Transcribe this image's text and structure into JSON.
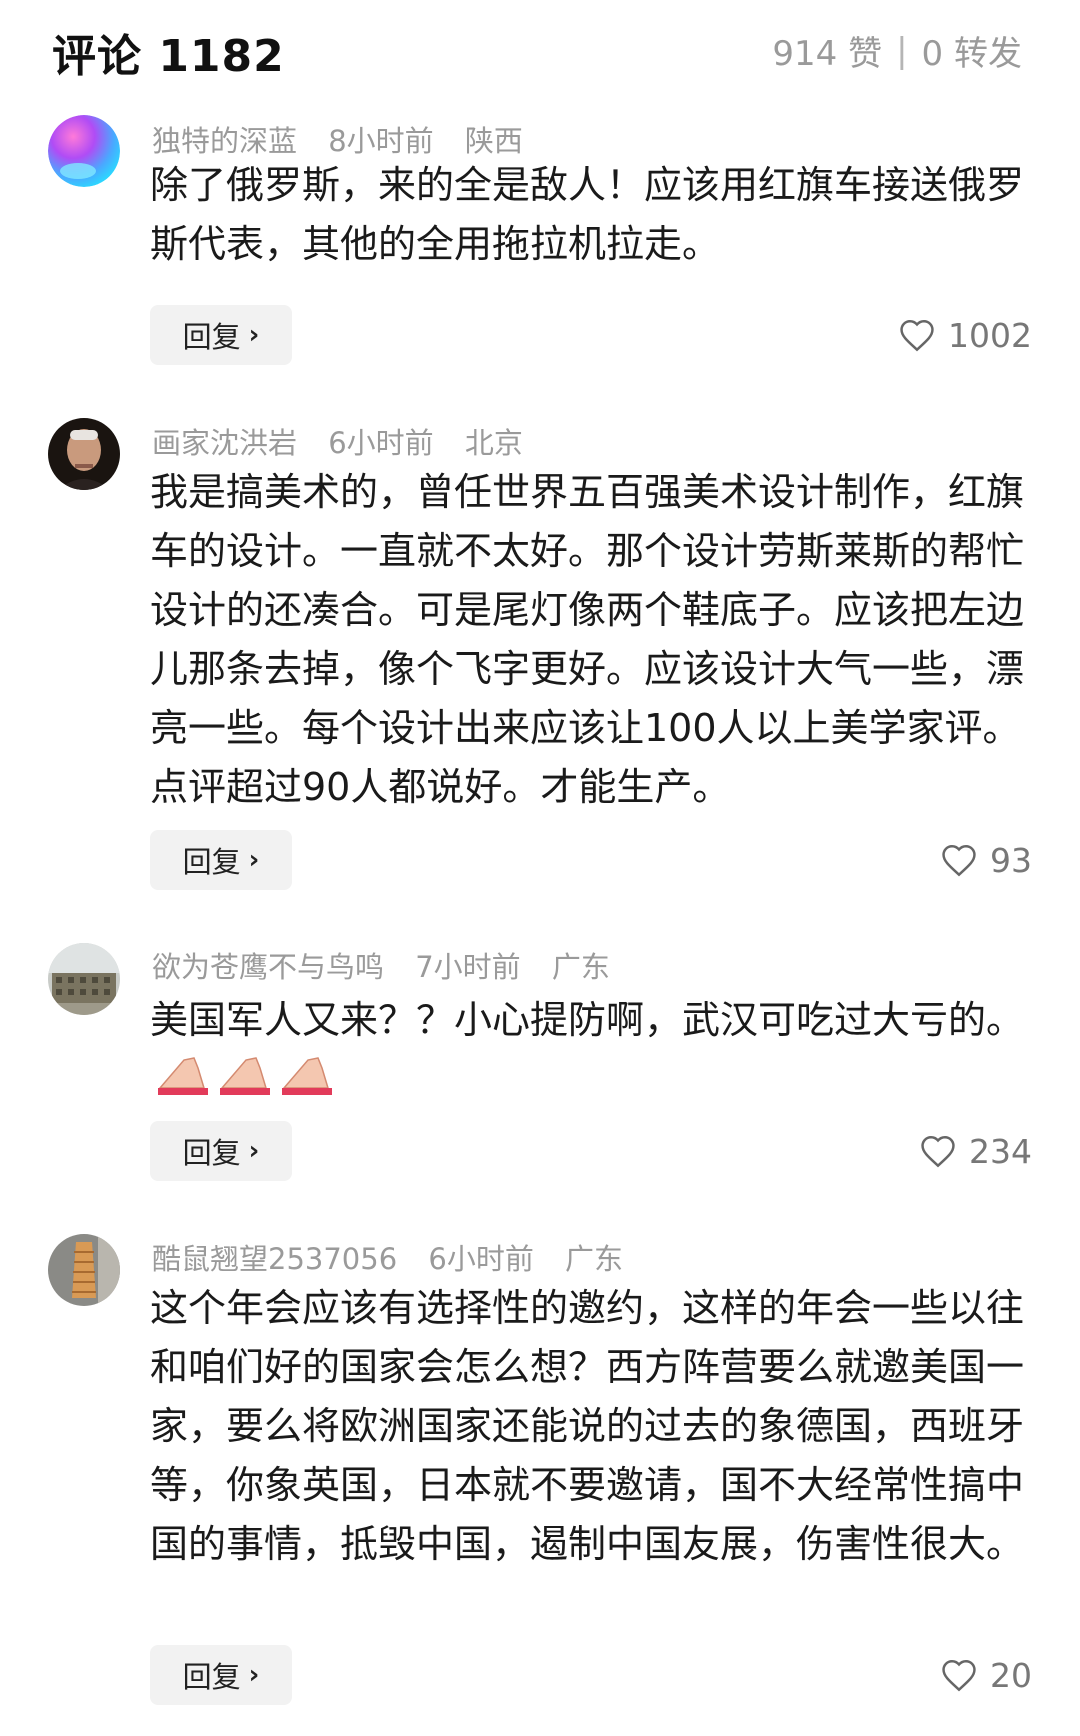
{
  "header": {
    "title": "评论 1182",
    "likes": "914 赞",
    "separator": "|",
    "reposts": "0 转发"
  },
  "comments": [
    {
      "user": "独特的深蓝",
      "time": "8小时前",
      "location": "陕西",
      "text": "除了俄罗斯，来的全是敌人！应该用红旗车接送俄罗斯代表，其他的全用拖拉机拉走。",
      "reply_label": "回复",
      "likes": "1002",
      "avatar_icon": "gradient-orb-avatar"
    },
    {
      "user": "画家沈洪岩",
      "time": "6小时前",
      "location": "北京",
      "text": "我是搞美术的，曾任世界五百强美术设计制作，红旗车的设计。一直就不太好。那个设计劳斯莱斯的帮忙设计的还凑合。可是尾灯像两个鞋底子。应该把左边儿那条去掉，像个飞字更好。应该设计大气一些，漂亮一些。每个设计出来应该让100人以上美学家评。点评超过90人都说好。才能生产。",
      "reply_label": "回复",
      "likes": "93",
      "avatar_icon": "portrait-avatar"
    },
    {
      "user": "欲为苍鹰不与鸟鸣",
      "time": "7小时前",
      "location": "广东",
      "text": "美国军人又来？？小心提防啊，武汉可吃过大亏的。",
      "reply_label": "回复",
      "likes": "234",
      "avatar_icon": "building-avatar",
      "emoji": "folded-hands-icon"
    },
    {
      "user": "酷鼠翘望2537056",
      "time": "6小时前",
      "location": "广东",
      "text": "这个年会应该有选择性的邀约，这样的年会一些以往和咱们好的国家会怎么想？西方阵营要么就邀美国一家，要么将欧洲国家还能说的过去的象德国，西班牙等，你象英国，日本就不要邀请，国不大经常性搞中国的事情，抵毁中国，遏制中国友展，伤害性很大。",
      "reply_label": "回复",
      "likes": "20",
      "avatar_icon": "tower-avatar"
    }
  ],
  "colors": {
    "meta_gray": "#9a9a9a",
    "reply_bg": "#f2f2f2",
    "text": "#1a1a1a"
  }
}
